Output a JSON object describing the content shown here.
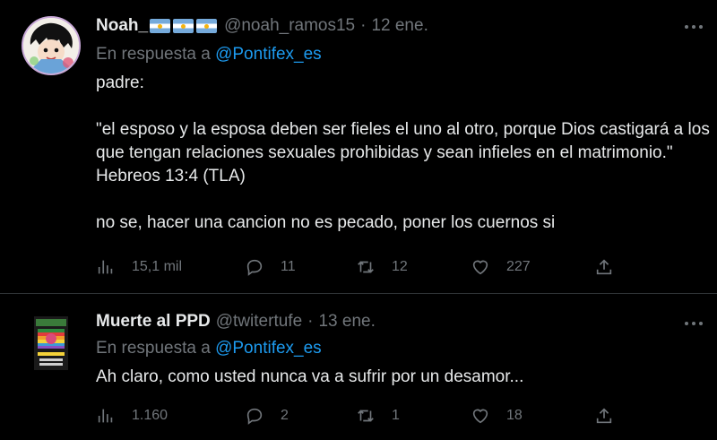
{
  "tweets": [
    {
      "display_name": "Noah_",
      "flags": [
        "argentina-flag",
        "argentina-flag",
        "argentina-flag"
      ],
      "handle": "@noah_ramos15",
      "separator": "·",
      "date": "12 ene.",
      "reply_prefix": "En respuesta a",
      "reply_to": "@Pontifex_es",
      "text": [
        "padre:",
        "",
        "\"el esposo y la esposa deben ser fieles el uno al otro, porque Dios castigará a los que tengan relaciones sexuales prohibidas y sean infieles en el matrimonio.\" Hebreos 13:4 (TLA)",
        "",
        "no se, hacer una cancion no es pecado, poner los cuernos si"
      ],
      "views": "15,1 mil",
      "replies": "11",
      "retweets": "12",
      "likes": "227"
    },
    {
      "display_name": "Muerte al PPD",
      "handle": "@twitertufe",
      "separator": "·",
      "date": "13 ene.",
      "reply_prefix": "En respuesta a",
      "reply_to": "@Pontifex_es",
      "text": [
        "Ah claro, como usted nunca va a sufrir por un desamor..."
      ],
      "views": "1.160",
      "replies": "2",
      "retweets": "1",
      "likes": "18"
    }
  ],
  "colors": {
    "background": "#000000",
    "text": "#e7e9ea",
    "muted": "#71767b",
    "link": "#1d9bf0",
    "divider": "#2f3336"
  }
}
